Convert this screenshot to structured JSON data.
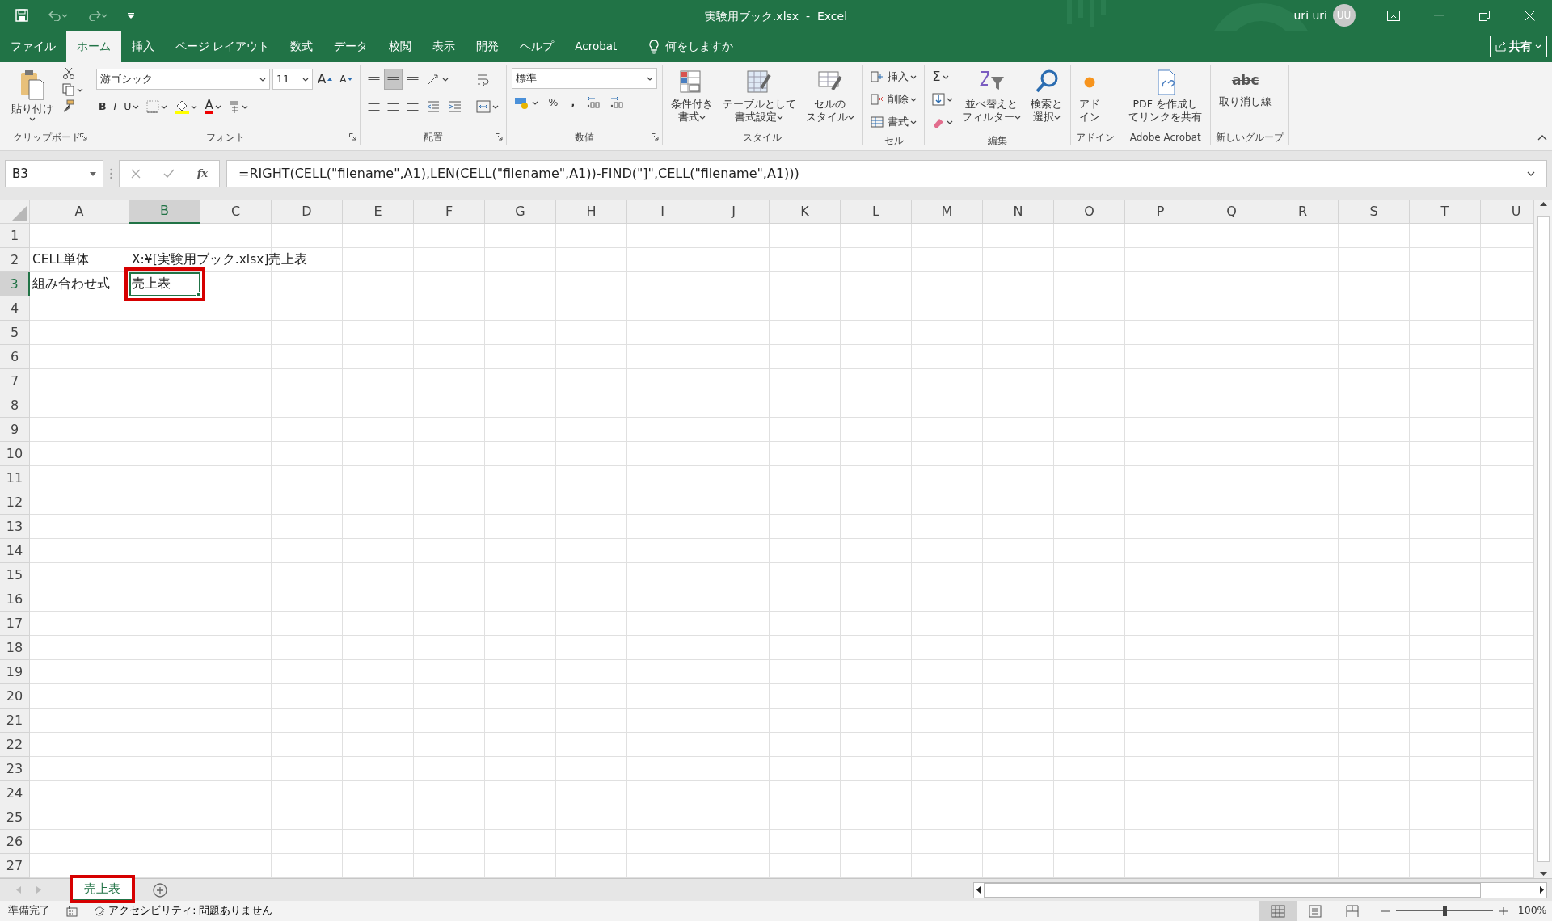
{
  "title_bar": {
    "title": "実験用ブック.xlsx  -  Excel",
    "user": "uri uri",
    "avatar": "UU"
  },
  "tabs": [
    {
      "label": "ファイル",
      "selected": false
    },
    {
      "label": "ホーム",
      "selected": true
    },
    {
      "label": "挿入",
      "selected": false
    },
    {
      "label": "ページ レイアウト",
      "selected": false
    },
    {
      "label": "数式",
      "selected": false
    },
    {
      "label": "データ",
      "selected": false
    },
    {
      "label": "校閲",
      "selected": false
    },
    {
      "label": "表示",
      "selected": false
    },
    {
      "label": "開発",
      "selected": false
    },
    {
      "label": "ヘルプ",
      "selected": false
    },
    {
      "label": "Acrobat",
      "selected": false
    }
  ],
  "tell_me": "何をしますか",
  "share": "共有",
  "ribbon": [
    {
      "kind": "clipboard",
      "label": "クリップボード",
      "launcher": true,
      "paste": "貼り付け"
    },
    {
      "kind": "font",
      "label": "フォント",
      "launcher": true,
      "font_name": "游ゴシック",
      "font_size": "11",
      "grow": "A",
      "shrink": "A",
      "bold": "B",
      "italic": "I",
      "underline": "U",
      "font_color": "A"
    },
    {
      "kind": "alignment",
      "label": "配置",
      "launcher": true,
      "vertical": [
        {
          "pressed": false
        },
        {
          "pressed": true
        },
        {
          "pressed": false
        }
      ],
      "horizontal": [
        {
          "pressed": false
        },
        {
          "pressed": false
        },
        {
          "pressed": false
        }
      ]
    },
    {
      "kind": "number",
      "label": "数値",
      "launcher": true,
      "format": "標準",
      "percent": "%",
      "comma": ","
    },
    {
      "kind": "styles",
      "label": "スタイル",
      "buttons": [
        {
          "kind": "conditional",
          "label": [
            "条件付き",
            "書式"
          ]
        },
        {
          "kind": "table",
          "label": [
            "テーブルとして",
            "書式設定"
          ]
        },
        {
          "kind": "cellstyle",
          "label": [
            "セルの",
            "スタイル"
          ]
        }
      ]
    },
    {
      "kind": "cells",
      "label": "セル",
      "buttons": [
        {
          "kind": "insert",
          "label": "挿入"
        },
        {
          "kind": "delete",
          "label": "削除"
        },
        {
          "kind": "format",
          "label": "書式"
        }
      ]
    },
    {
      "kind": "editing",
      "label": "編集",
      "autosum": "Σ",
      "buttons": [
        {
          "kind": "sort",
          "label": [
            "並べ替えと",
            "フィルター"
          ]
        },
        {
          "kind": "find",
          "label": [
            "検索と",
            "選択"
          ]
        }
      ]
    },
    {
      "kind": "addins",
      "label": "アドイン",
      "button": [
        "アド",
        "イン"
      ]
    },
    {
      "kind": "acrobat",
      "label": "Adobe Acrobat",
      "button": [
        "PDF を作成し",
        "てリンクを共有"
      ]
    },
    {
      "kind": "newgroup",
      "label": "新しいグループ",
      "icon_text": "abc",
      "button": [
        "取り消し線"
      ]
    }
  ],
  "formula_bar": {
    "name_box": "B3",
    "function_label": "fx",
    "formula": "=RIGHT(CELL(\"filename\",A1),LEN(CELL(\"filename\",A1))-FIND(\"]\",CELL(\"filename\",A1)))"
  },
  "grid": {
    "columns": [
      {
        "label": "A",
        "selected": false
      },
      {
        "label": "B",
        "selected": true
      },
      {
        "label": "C",
        "selected": false
      },
      {
        "label": "D",
        "selected": false
      },
      {
        "label": "E",
        "selected": false
      },
      {
        "label": "F",
        "selected": false
      },
      {
        "label": "G",
        "selected": false
      },
      {
        "label": "H",
        "selected": false
      },
      {
        "label": "I",
        "selected": false
      },
      {
        "label": "J",
        "selected": false
      },
      {
        "label": "K",
        "selected": false
      },
      {
        "label": "L",
        "selected": false
      },
      {
        "label": "M",
        "selected": false
      },
      {
        "label": "N",
        "selected": false
      },
      {
        "label": "O",
        "selected": false
      },
      {
        "label": "P",
        "selected": false
      },
      {
        "label": "Q",
        "selected": false
      },
      {
        "label": "R",
        "selected": false
      },
      {
        "label": "S",
        "selected": false
      },
      {
        "label": "T",
        "selected": false
      },
      {
        "label": "U",
        "selected": false
      }
    ],
    "rows": [
      {
        "label": "1",
        "selected": false
      },
      {
        "label": "2",
        "selected": false,
        "cells": [
          {
            "value": "CELL単体",
            "active": false,
            "highlighted": false
          },
          {
            "value": "X:¥[実験用ブック.xlsx]売上表",
            "active": false,
            "highlighted": false
          }
        ]
      },
      {
        "label": "3",
        "selected": true,
        "cells": [
          {
            "value": "組み合わせ式",
            "active": false,
            "highlighted": false
          },
          {
            "value": "売上表",
            "active": true,
            "highlighted": true
          }
        ]
      },
      {
        "label": "4",
        "selected": false
      },
      {
        "label": "5",
        "selected": false
      },
      {
        "label": "6",
        "selected": false
      },
      {
        "label": "7",
        "selected": false
      },
      {
        "label": "8",
        "selected": false
      },
      {
        "label": "9",
        "selected": false
      },
      {
        "label": "10",
        "selected": false
      },
      {
        "label": "11",
        "selected": false
      },
      {
        "label": "12",
        "selected": false
      },
      {
        "label": "13",
        "selected": false
      },
      {
        "label": "14",
        "selected": false
      },
      {
        "label": "15",
        "selected": false
      },
      {
        "label": "16",
        "selected": false
      },
      {
        "label": "17",
        "selected": false
      },
      {
        "label": "18",
        "selected": false
      },
      {
        "label": "19",
        "selected": false
      },
      {
        "label": "20",
        "selected": false
      },
      {
        "label": "21",
        "selected": false
      },
      {
        "label": "22",
        "selected": false
      },
      {
        "label": "23",
        "selected": false
      },
      {
        "label": "24",
        "selected": false
      },
      {
        "label": "25",
        "selected": false
      },
      {
        "label": "26",
        "selected": false
      },
      {
        "label": "27",
        "selected": false
      }
    ]
  },
  "sheets": [
    {
      "label": "売上表",
      "selected": true,
      "highlighted": true
    }
  ],
  "status_bar": {
    "ready": "準備完了",
    "accessibility": "アクセシビリティ: 問題ありません",
    "views": [
      {
        "selected": true
      },
      {
        "selected": false
      },
      {
        "selected": false
      }
    ],
    "zoom": {
      "level": 0.5
    },
    "zoom_label": "100%"
  }
}
